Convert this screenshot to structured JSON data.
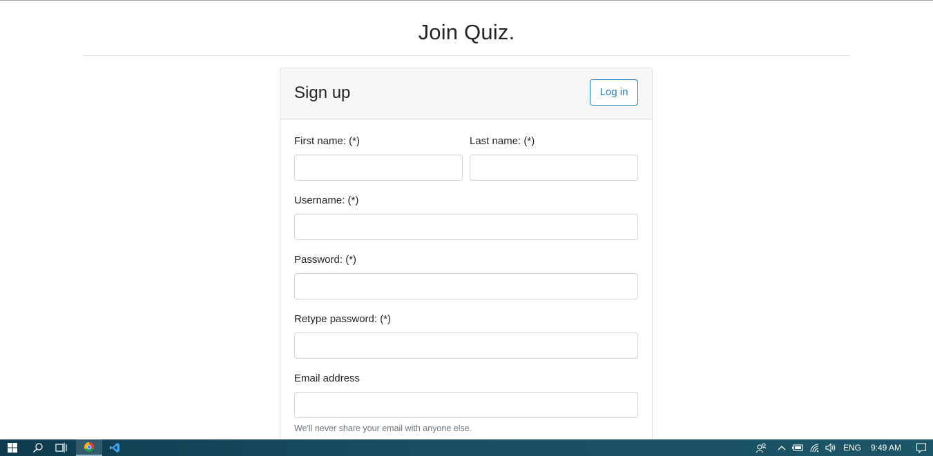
{
  "page": {
    "title": "Join Quiz."
  },
  "card": {
    "title": "Sign up",
    "login_label": "Log in"
  },
  "form": {
    "first_name_label": "First name: (*)",
    "last_name_label": "Last name: (*)",
    "username_label": "Username: (*)",
    "password_label": "Password: (*)",
    "retype_password_label": "Retype password: (*)",
    "email_label": "Email address",
    "email_help": "We'll never share your email with anyone else.",
    "first_name_value": "",
    "last_name_value": "",
    "username_value": "",
    "password_value": "",
    "retype_password_value": "",
    "email_value": ""
  },
  "taskbar": {
    "language": "ENG",
    "time": "9:49 AM",
    "icons": [
      "windows-start-icon",
      "search-icon",
      "task-view-icon",
      "chrome-icon",
      "vscode-icon",
      "people-icon",
      "chevron-up-icon",
      "battery-icon",
      "wifi-icon",
      "volume-icon",
      "notification-icon"
    ]
  },
  "colors": {
    "accent": "#1f7bc0",
    "taskbar": "#184f62"
  }
}
